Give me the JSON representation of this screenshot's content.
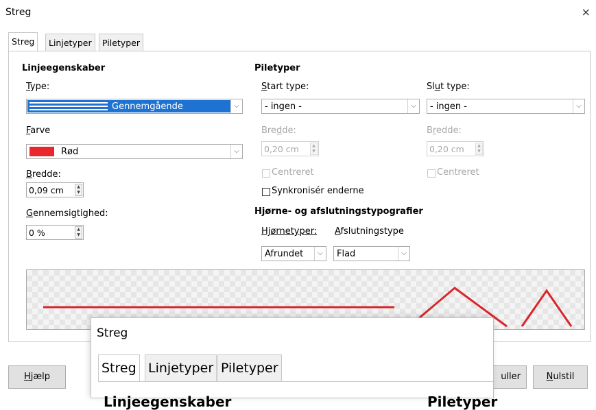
{
  "window": {
    "title": "Streg",
    "close": "×"
  },
  "tabs": [
    "Streg",
    "Linjetyper",
    "Piletyper"
  ],
  "line_props": {
    "heading": "Linjeegenskaber",
    "type_label": "Type:",
    "type_value": "Gennemgående",
    "color_label": "Farve",
    "color_value": "Rød",
    "color_swatch": "#e8262b",
    "width_label": "Bredde:",
    "width_value": "0,09 cm",
    "transparency_label": "Gennemsigtighed:",
    "transparency_value": "0 %"
  },
  "arrows": {
    "heading": "Piletyper",
    "start_label": "Start type:",
    "start_value": "- ingen -",
    "end_label": "Slut type:",
    "end_value": "- ingen -",
    "start_width_label": "Bredde:",
    "start_width_value": "0,20 cm",
    "end_width_label": "Bredde:",
    "end_width_value": "0,20 cm",
    "start_center": "Centreret",
    "end_center": "Centreret",
    "sync": "Synkronisér enderne"
  },
  "corners": {
    "heading": "Hjørne- og afslutningstypografier",
    "corner_label": "Hjørnetyper:",
    "corner_value": "Afrundet",
    "cap_label": "Afslutningstype",
    "cap_value": "Flad"
  },
  "preview": {
    "line_color": "#d9262b"
  },
  "buttons": {
    "help": "Hjælp",
    "cancel_partial": "uller",
    "reset": "Nulstil"
  },
  "popup": {
    "title": "Streg",
    "tabs": [
      "Streg",
      "Linjetyper",
      "Piletyper"
    ],
    "cut_left": "Linjeegenskaber",
    "cut_right": "Piletyper"
  }
}
